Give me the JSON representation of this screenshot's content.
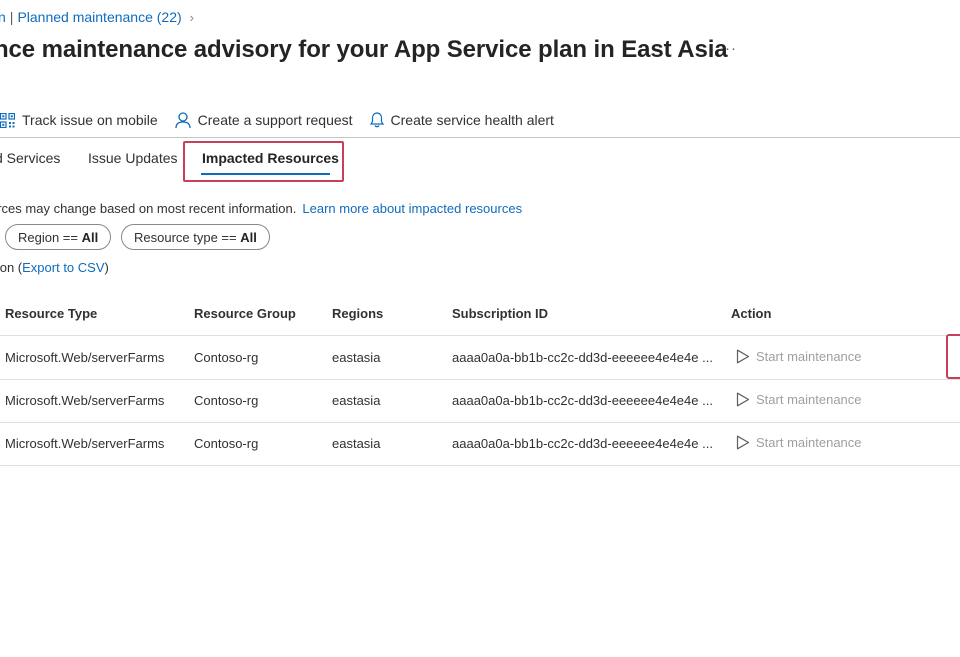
{
  "breadcrumb": {
    "first_fragment": "n",
    "second": "Planned maintenance (22)"
  },
  "title": "nce maintenance advisory for your App Service plan in East Asia",
  "more_label": "···",
  "toolbar": {
    "track_mobile": "Track issue on mobile",
    "support_request": "Create a support request",
    "health_alert": "Create service health alert"
  },
  "tabs": [
    {
      "label": "d Services"
    },
    {
      "label": "Issue Updates"
    },
    {
      "label": "Impacted Resources"
    }
  ],
  "info": {
    "text": "urces may change based on most recent information.",
    "link": "Learn more about impacted resources"
  },
  "filters": {
    "region": {
      "key": "Region == ",
      "value": "All"
    },
    "resource_type": {
      "key": "Resource type == ",
      "value": "All"
    }
  },
  "export": {
    "prefix": "ption (",
    "link": "Export to CSV",
    "suffix": ")"
  },
  "table": {
    "headers": [
      "Resource Type",
      "Resource Group",
      "Regions",
      "Subscription ID",
      "Action"
    ],
    "rows": [
      {
        "type": "Microsoft.Web/serverFarms",
        "group": "Contoso-rg",
        "region": "eastasia",
        "subscription": "aaaa0a0a-bb1b-cc2c-dd3d-eeeeee4e4e4e ...",
        "action": "Start maintenance"
      },
      {
        "type": "Microsoft.Web/serverFarms",
        "group": "Contoso-rg",
        "region": "eastasia",
        "subscription": "aaaa0a0a-bb1b-cc2c-dd3d-eeeeee4e4e4e ...",
        "action": "Start maintenance"
      },
      {
        "type": "Microsoft.Web/serverFarms",
        "group": "Contoso-rg",
        "region": "eastasia",
        "subscription": "aaaa0a0a-bb1b-cc2c-dd3d-eeeeee4e4e4e ...",
        "action": "Start maintenance"
      }
    ]
  },
  "colors": {
    "accent": "#0f6cbd",
    "highlight": "#c6405a",
    "disabled": "#a19f9d"
  }
}
